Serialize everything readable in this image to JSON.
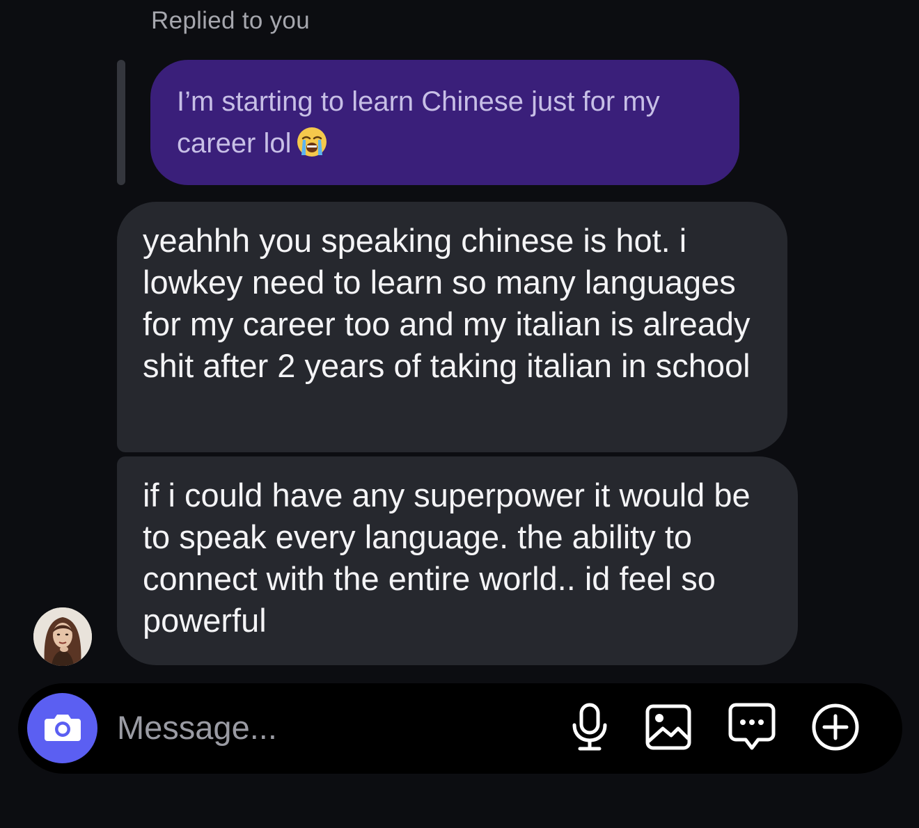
{
  "reply": {
    "label": "Replied to you",
    "quoted_message": "I’m starting to learn Chinese just for my career lol",
    "quoted_emoji": "loudly-crying-face-emoji"
  },
  "messages": [
    {
      "text": "yeahhh you speaking chinese is hot. i lowkey need to learn so many languages for my career too and my italian is already shit after 2 years of taking italian in school"
    },
    {
      "text": "if i could have any superpower it would be to speak every language. the ability to connect with the entire world.. id feel so powerful"
    }
  ],
  "composer": {
    "placeholder": "Message...",
    "icons": [
      "camera-icon",
      "microphone-icon",
      "gallery-icon",
      "sticker-icon",
      "plus-icon"
    ]
  },
  "colors": {
    "background": "#0c0d11",
    "quoted_bubble": "#3a1f7a",
    "received_bubble": "#26282e",
    "camera_accent": "#5b5ff2"
  }
}
